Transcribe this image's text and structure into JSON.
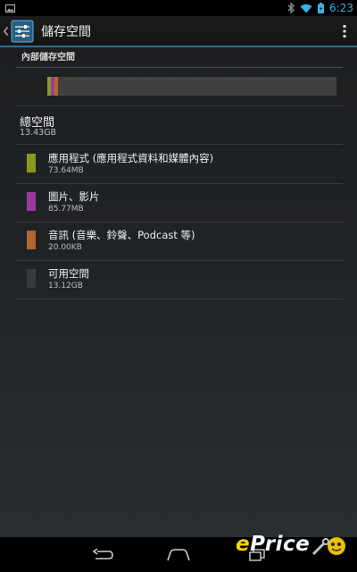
{
  "status_bar": {
    "time": "6:23",
    "left_icon": "image-notification-icon",
    "right_icons": [
      "bluetooth-icon",
      "wifi-icon",
      "battery-icon"
    ]
  },
  "action_bar": {
    "title": "儲存空間",
    "up_icon": "chevron-left-icon",
    "app_icon": "settings-sliders-icon",
    "overflow_icon": "overflow-menu-icon"
  },
  "storage": {
    "section_title": "內部儲存空間",
    "total_label": "總空間",
    "total_value": "13.43GB",
    "items": [
      {
        "label": "應用程式 (應用程式資料和媒體內容)",
        "value": "73.64MB",
        "color": "#8b9a1e"
      },
      {
        "label": "圖片、影片",
        "value": "85.77MB",
        "color": "#9b3a9e"
      },
      {
        "label": "音訊 (音樂、鈴聲、Podcast 等)",
        "value": "20.00KB",
        "color": "#b4662e"
      },
      {
        "label": "可用空間",
        "value": "13.12GB",
        "color": "#3a3a3a"
      }
    ],
    "usage_fraction_used": 0.025
  },
  "nav_bar": {
    "icons": [
      "back-icon",
      "home-icon",
      "recents-icon"
    ]
  },
  "watermark": {
    "text_e": "e",
    "text_rest": "Price"
  }
}
